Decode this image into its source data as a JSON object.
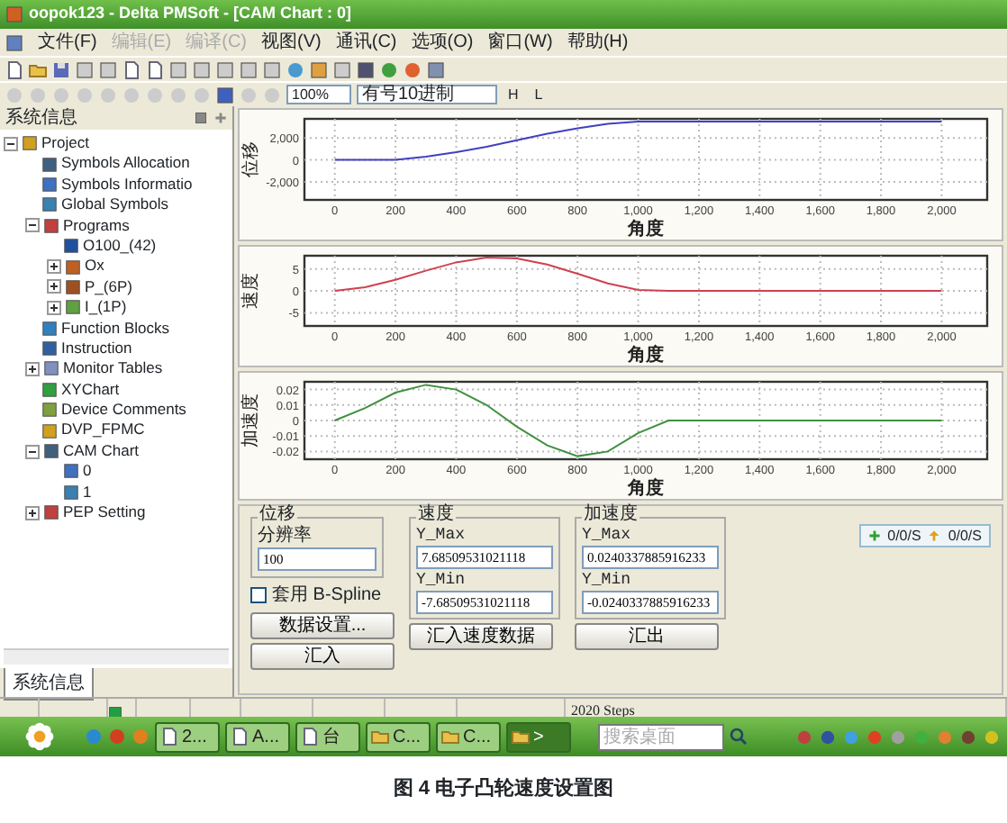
{
  "window": {
    "title": "oopok123 - Delta PMSoft - [CAM Chart : 0]"
  },
  "menu": [
    {
      "label": "文件(F)",
      "disabled": false
    },
    {
      "label": "编辑(E)",
      "disabled": true
    },
    {
      "label": "编译(C)",
      "disabled": true
    },
    {
      "label": "视图(V)",
      "disabled": false
    },
    {
      "label": "通讯(C)",
      "disabled": false
    },
    {
      "label": "选项(O)",
      "disabled": false
    },
    {
      "label": "窗口(W)",
      "disabled": false
    },
    {
      "label": "帮助(H)",
      "disabled": false
    }
  ],
  "toolbar": {
    "zoom": "100%",
    "format": "有号10进制",
    "buttons": [
      "H",
      "L"
    ]
  },
  "sidebar": {
    "title": "系统信息",
    "tab": "系统信息",
    "tree": [
      {
        "label": "Project",
        "expanded": true,
        "children": [
          {
            "label": "Symbols Allocation"
          },
          {
            "label": "Symbols Informatio"
          },
          {
            "label": "Global Symbols"
          },
          {
            "label": "Programs",
            "expanded": true,
            "children": [
              {
                "label": "O100_(42)"
              },
              {
                "label": "Ox",
                "expanded": false
              },
              {
                "label": "P_(6P)",
                "expanded": false
              },
              {
                "label": "I_(1P)",
                "expanded": false
              }
            ]
          },
          {
            "label": "Function Blocks"
          },
          {
            "label": "Instruction"
          },
          {
            "label": "Monitor Tables",
            "expanded": false
          },
          {
            "label": "XYChart"
          },
          {
            "label": "Device Comments"
          },
          {
            "label": "DVP_FPMC"
          },
          {
            "label": "CAM Chart",
            "expanded": true,
            "children": [
              {
                "label": "0"
              },
              {
                "label": "1"
              }
            ]
          },
          {
            "label": "PEP Setting",
            "expanded": false
          }
        ]
      }
    ]
  },
  "charts": [
    {
      "chart_data": {
        "type": "line",
        "xlabel": "角度",
        "ylabel": "位移",
        "x": [
          0,
          100,
          200,
          300,
          400,
          500,
          600,
          700,
          800,
          900,
          1000,
          1100,
          1200,
          1300,
          1400,
          1500,
          1600,
          1700,
          1800,
          1900,
          2000
        ],
        "xlim": [
          -100,
          2150
        ],
        "ylim": [
          -3650,
          3750
        ],
        "xticks": [
          0,
          200,
          400,
          600,
          800,
          {
            "value": 1000,
            "label": "1,000"
          },
          {
            "value": 1200,
            "label": "1,200"
          },
          {
            "value": 1400,
            "label": "1,400"
          },
          {
            "value": 1600,
            "label": "1,600"
          },
          {
            "value": 1800,
            "label": "1,800"
          },
          {
            "value": 2000,
            "label": "2,000"
          }
        ],
        "yticks": [
          {
            "value": 2000,
            "label": "2,000"
          },
          0,
          {
            "value": -2000,
            "label": "-2,000"
          }
        ],
        "grid": true,
        "series": [
          {
            "color": "#4040c0",
            "values": [
              0,
              0,
              0,
              300,
              700,
              1200,
              1800,
              2400,
              2900,
              3300,
              3500,
              3500,
              3500,
              3500,
              3500,
              3500,
              3500,
              3500,
              3500,
              3500,
              3500
            ]
          }
        ]
      }
    },
    {
      "chart_data": {
        "type": "line",
        "xlabel": "角度",
        "ylabel": "速度",
        "x": [
          0,
          100,
          200,
          300,
          400,
          500,
          600,
          700,
          800,
          900,
          1000,
          1100,
          1200,
          1300,
          1400,
          1500,
          1600,
          1700,
          1800,
          1900,
          2000
        ],
        "xlim": [
          -100,
          2150
        ],
        "ylim": [
          -8,
          8
        ],
        "xticks": [
          0,
          200,
          400,
          600,
          800,
          {
            "value": 1000,
            "label": "1,000"
          },
          {
            "value": 1200,
            "label": "1,200"
          },
          {
            "value": 1400,
            "label": "1,400"
          },
          {
            "value": 1600,
            "label": "1,600"
          },
          {
            "value": 1800,
            "label": "1,800"
          },
          {
            "value": 2000,
            "label": "2,000"
          }
        ],
        "yticks": [
          5,
          0,
          -5
        ],
        "grid": true,
        "series": [
          {
            "color": "#d04050",
            "values": [
              0,
              0.8,
              2.5,
              4.6,
              6.5,
              7.6,
              7.4,
              6,
              3.9,
              1.7,
              0.2,
              0,
              0,
              0,
              0,
              0,
              0,
              0,
              0,
              0,
              0
            ]
          }
        ]
      }
    },
    {
      "chart_data": {
        "type": "line",
        "xlabel": "角度",
        "ylabel": "加速度",
        "x": [
          0,
          100,
          200,
          300,
          400,
          500,
          600,
          700,
          800,
          900,
          1000,
          1100,
          1200,
          1300,
          1400,
          1500,
          1600,
          1700,
          1800,
          1900,
          2000
        ],
        "xlim": [
          -100,
          2150
        ],
        "ylim": [
          -0.025,
          0.025
        ],
        "xticks": [
          0,
          200,
          400,
          600,
          800,
          {
            "value": 1000,
            "label": "1,000"
          },
          {
            "value": 1200,
            "label": "1,200"
          },
          {
            "value": 1400,
            "label": "1,400"
          },
          {
            "value": 1600,
            "label": "1,600"
          },
          {
            "value": 1800,
            "label": "1,800"
          },
          {
            "value": 2000,
            "label": "2,000"
          }
        ],
        "yticks": [
          0.02,
          0.01,
          0,
          -0.01,
          -0.02
        ],
        "grid": true,
        "series": [
          {
            "color": "#409040",
            "values": [
              0,
              0.008,
              0.018,
              0.023,
              0.02,
              0.01,
              -0.004,
              -0.016,
              -0.023,
              -0.02,
              -0.008,
              0,
              0,
              0,
              0,
              0,
              0,
              0,
              0,
              0,
              0
            ]
          }
        ]
      }
    }
  ],
  "displacement": {
    "title": "位移",
    "resolution_label": "分辨率",
    "resolution": "100",
    "bspline": {
      "label": "套用 B-Spline",
      "checked": false
    },
    "buttons": [
      "数据设置...",
      "汇入"
    ]
  },
  "velocity": {
    "title": "速度",
    "max_label": "Y_Max",
    "max": "7.68509531021118",
    "min_label": "Y_Min",
    "min": "-7.68509531021118",
    "button": "汇入速度数据"
  },
  "acceleration": {
    "title": "加速度",
    "max_label": "Y_Max",
    "max": "0.0240337885916233",
    "min_label": "Y_Min",
    "min": "-0.0240337885916233",
    "button": "汇出"
  },
  "rates": [
    "0/0/S",
    "0/0/S"
  ],
  "status_bar": {
    "steps": "2020 Steps"
  },
  "taskbar": {
    "tasks": [
      {
        "label": "2...",
        "selected": false
      },
      {
        "label": "A...",
        "selected": false
      },
      {
        "label": "台",
        "selected": false
      },
      {
        "label": "C...",
        "selected": false
      },
      {
        "label": "C...",
        "selected": false
      },
      {
        "label": ">",
        "selected": true
      }
    ],
    "search": {
      "placeholder": "搜索桌面"
    }
  },
  "caption": "图 4 电子凸轮速度设置图"
}
